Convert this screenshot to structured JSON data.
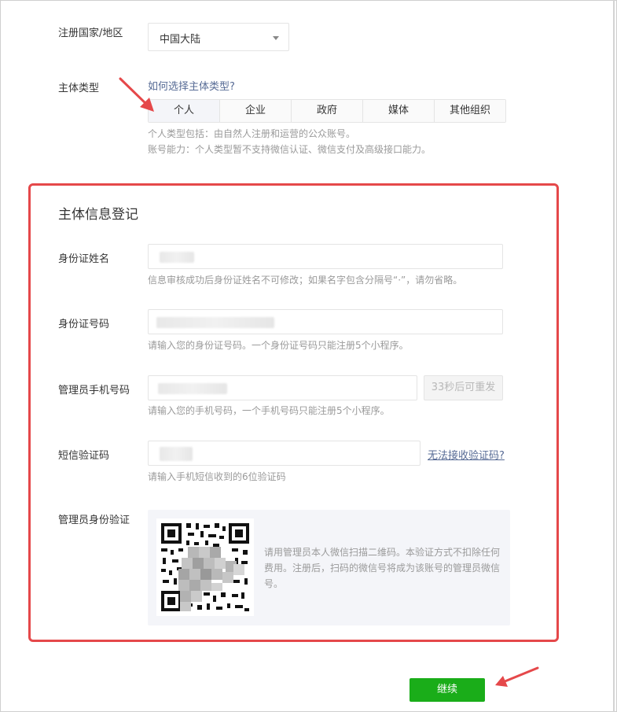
{
  "region": {
    "label": "注册国家/地区",
    "value": "中国大陆"
  },
  "subject_type": {
    "label": "主体类型",
    "help_link": "如何选择主体类型?",
    "options": [
      "个人",
      "企业",
      "政府",
      "媒体",
      "其他组织"
    ],
    "selected": "个人",
    "desc_line1": "个人类型包括：由自然人注册和运营的公众账号。",
    "desc_line2": "账号能力：个人类型暂不支持微信认证、微信支付及高级接口能力。"
  },
  "section": {
    "title": "主体信息登记",
    "id_name": {
      "label": "身份证姓名",
      "hint": "信息审核成功后身份证姓名不可修改；如果名字包含分隔号“·”，请勿省略。"
    },
    "id_number": {
      "label": "身份证号码",
      "hint": "请输入您的身份证号码。一个身份证号码只能注册5个小程序。"
    },
    "phone": {
      "label": "管理员手机号码",
      "hint": "请输入您的手机号码，一个手机号码只能注册5个小程序。",
      "resend_button": "33秒后可重发"
    },
    "sms_code": {
      "label": "短信验证码",
      "hint": "请输入手机短信收到的6位验证码",
      "help_link": "无法接收验证码?"
    },
    "admin_verify": {
      "label": "管理员身份验证",
      "qr_text": "请用管理员本人微信扫描二维码。本验证方式不扣除任何费用。注册后，扫码的微信号将成为该账号的管理员微信号。"
    }
  },
  "continue_button": "继续",
  "colors": {
    "primary": "#1aad19",
    "link": "#576b95",
    "highlight": "#e5484a"
  }
}
